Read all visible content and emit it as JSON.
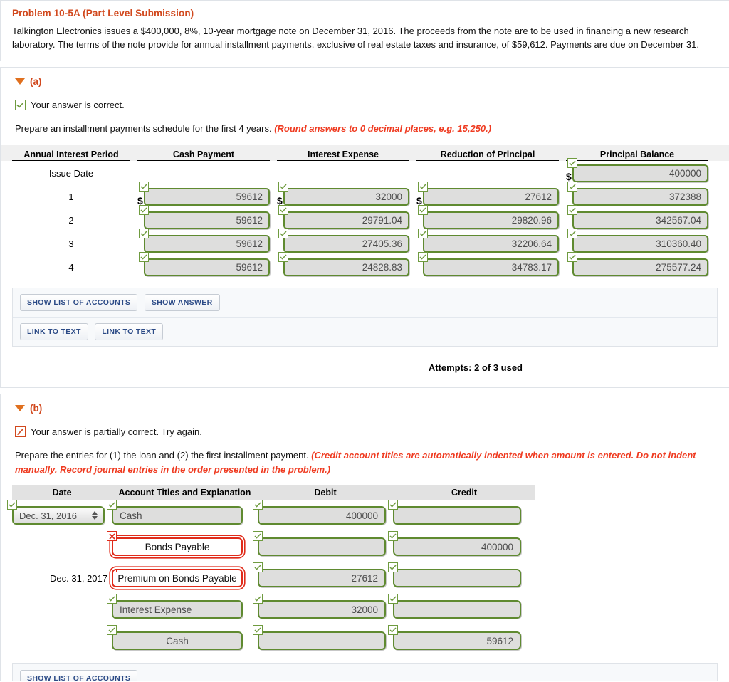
{
  "problem": {
    "title": "Problem 10-5A (Part Level Submission)",
    "body": "Talkington Electronics issues a $400,000, 8%, 10-year mortgage note on December 31, 2016. The proceeds from the note are to be used in financing a new research laboratory. The terms of the note provide for annual installment payments, exclusive of real estate taxes and insurance, of $59,612. Payments are due on December 31."
  },
  "part_a": {
    "label": "(a)",
    "status": "Your answer is correct.",
    "status_icon": "check-icon",
    "instruction": "Prepare an installment payments schedule for the first 4 years.",
    "hint": "(Round answers to 0 decimal places, e.g. 15,250.)",
    "table": {
      "headers": [
        "Annual Interest Period",
        "Cash Payment",
        "Interest Expense",
        "Reduction of Principal",
        "Principal Balance"
      ],
      "rows": [
        {
          "period": "Issue Date",
          "cash_payment": "",
          "interest_expense": "",
          "reduction": "",
          "balance": "400000",
          "show_balance_dollar": true
        },
        {
          "period": "1",
          "cash_payment": "59612",
          "interest_expense": "32000",
          "reduction": "27612",
          "balance": "372388",
          "show_dollars": true
        },
        {
          "period": "2",
          "cash_payment": "59612",
          "interest_expense": "29791.04",
          "reduction": "29820.96",
          "balance": "342567.04"
        },
        {
          "period": "3",
          "cash_payment": "59612",
          "interest_expense": "27405.36",
          "reduction": "32206.64",
          "balance": "310360.40"
        },
        {
          "period": "4",
          "cash_payment": "59612",
          "interest_expense": "24828.83",
          "reduction": "34783.17",
          "balance": "275577.24"
        }
      ]
    },
    "buttons_row1": [
      "SHOW LIST OF ACCOUNTS",
      "SHOW ANSWER"
    ],
    "buttons_row2": [
      "LINK TO TEXT",
      "LINK TO TEXT"
    ],
    "attempts": "Attempts: 2 of 3 used"
  },
  "part_b": {
    "label": "(b)",
    "status": "Your answer is partially correct.  Try again.",
    "status_icon": "partial-icon",
    "instruction": "Prepare the entries for (1) the loan and (2) the first installment payment.",
    "hint": "(Credit account titles are automatically indented when amount is entered. Do not indent manually. Record journal entries in the order presented in the problem.)",
    "table": {
      "headers": [
        "Date",
        "Account Titles and Explanation",
        "Debit",
        "Credit"
      ],
      "rows": [
        {
          "date_value": "Dec. 31, 2016",
          "date_type": "select",
          "account": "Cash",
          "account_state": "ok",
          "account_align": "left",
          "debit": "400000",
          "credit": ""
        },
        {
          "date_value": "",
          "date_type": "none",
          "account": "Bonds Payable",
          "account_state": "error",
          "account_align": "center",
          "debit": "",
          "credit": "400000"
        },
        {
          "date_value": "Dec. 31, 2017",
          "date_type": "text",
          "account": "Premium on Bonds Payable",
          "account_state": "error",
          "account_align": "center",
          "debit": "27612",
          "credit": ""
        },
        {
          "date_value": "",
          "date_type": "none",
          "account": "Interest Expense",
          "account_state": "ok",
          "account_align": "left",
          "debit": "32000",
          "credit": ""
        },
        {
          "date_value": "",
          "date_type": "none",
          "account": "Cash",
          "account_state": "ok",
          "account_align": "center",
          "debit": "",
          "credit": "59612"
        }
      ]
    },
    "bottom_button": "SHOW LIST OF ACCOUNTS"
  },
  "colors": {
    "accent": "#d1481d",
    "field_border_ok": "#5f8a30",
    "field_border_error": "#e02b1a",
    "field_fill": "#dededd",
    "hint": "#ef3b21",
    "button_text": "#2b4a86"
  }
}
